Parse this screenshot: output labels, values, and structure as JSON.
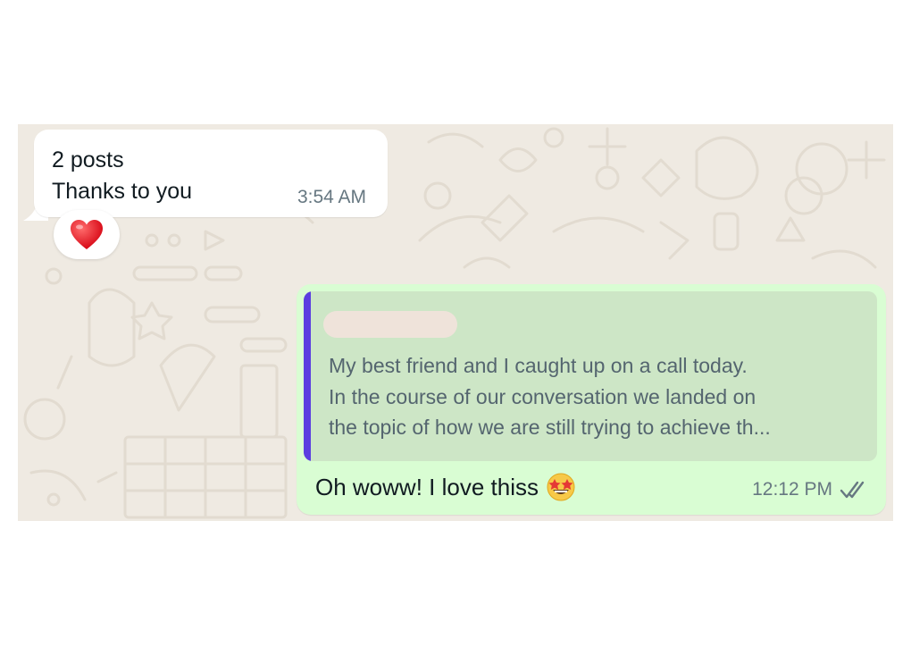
{
  "incoming": {
    "lines": [
      "2 posts",
      "Thanks to you"
    ],
    "time": "3:54 AM",
    "reaction_icon": "red-heart-icon"
  },
  "outgoing": {
    "quote_lines": [
      "My best friend and I caught up on a call today.",
      "In the course of our conversation we landed on",
      "the topic of how we are still trying to achieve th..."
    ],
    "text": "Oh woww! I love thiss",
    "emoji_icon": "star-struck-emoji-icon",
    "time": "12:12 PM",
    "status_icon": "double-check-icon"
  },
  "colors": {
    "chat_background": "#efeae2",
    "incoming_bubble": "#ffffff",
    "outgoing_bubble": "#d9fdd3",
    "quote_background": "#cde6c6",
    "quote_bar": "#5b3de0"
  }
}
